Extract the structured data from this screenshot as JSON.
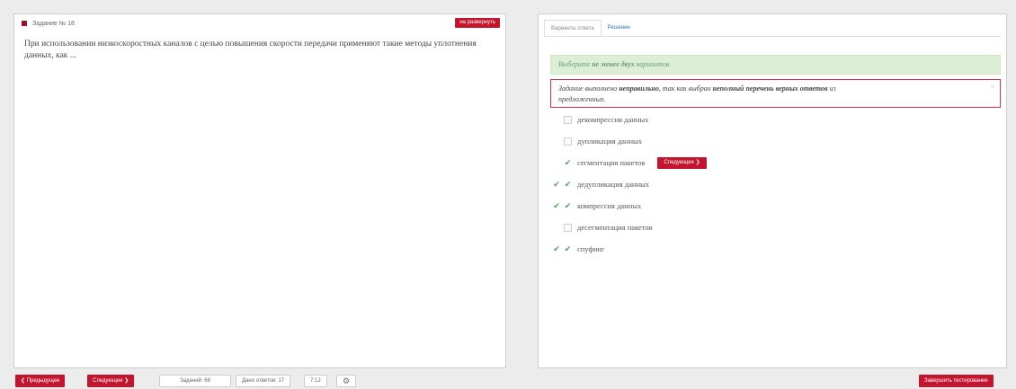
{
  "task": {
    "number_label": "Задание № 18",
    "expand_label": "на развернуть",
    "question": "При использовании низкоскоростных каналов с целью повышения скорости передачи применяют такие методы уплотнения данных, как ..."
  },
  "tabs": [
    {
      "label": "Варианты ответа"
    },
    {
      "label": "Решение"
    }
  ],
  "hint": {
    "prefix": "Выберите ",
    "bold": "не менее двух",
    "suffix": " вариантов"
  },
  "error": {
    "part1": "Задание выполнено ",
    "bold1": "неправильно",
    "part2": ", так как выбран ",
    "bold2": "неполный перечень верных ответов",
    "part3": " из",
    "line2": "предложенных.",
    "close": "×"
  },
  "options": [
    {
      "label": "декомпрессия данных",
      "checked": false,
      "correct": false
    },
    {
      "label": "дупликация данных",
      "checked": false,
      "correct": false
    },
    {
      "label": "сегментация пакетов",
      "checked": true,
      "correct": false
    },
    {
      "label": "дедупликация данных",
      "checked": true,
      "correct": true
    },
    {
      "label": "компрессия данных",
      "checked": true,
      "correct": true
    },
    {
      "label": "десегментация пакетов",
      "checked": false,
      "correct": false
    },
    {
      "label": "спуфинг",
      "checked": true,
      "correct": true
    }
  ],
  "next_inline_label": "Следующее ❯",
  "check_glyph": "✔",
  "bottom": {
    "prev": "❮ Предыдущее",
    "next": "Следующее ❯",
    "tasks": "Заданий: 68",
    "answers": "Дано ответов: 17",
    "time": "7:12",
    "settings_icon": "⚙",
    "finish": "Завершить тестирование"
  },
  "colors": {
    "accent": "#c4152f",
    "success_bg": "#dcefd4",
    "check_green": "#4aa04a"
  }
}
